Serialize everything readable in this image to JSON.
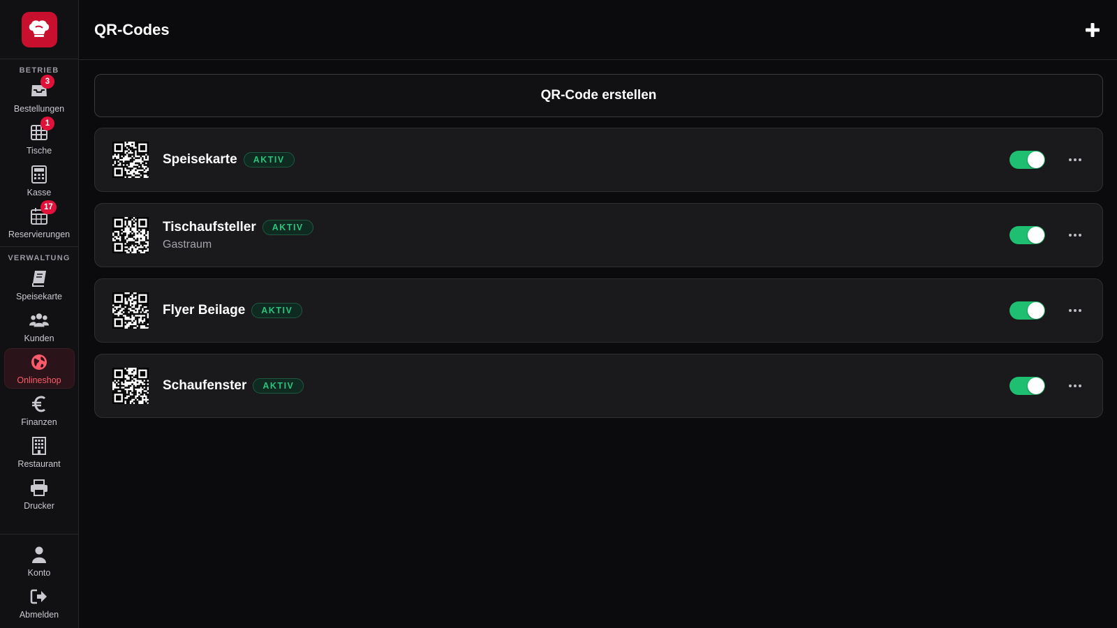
{
  "sidebar": {
    "sections": [
      {
        "label": "BETRIEB",
        "items": [
          {
            "label": "Bestellungen",
            "icon": "inbox-icon",
            "badge": "3"
          },
          {
            "label": "Tische",
            "icon": "table-grid-icon",
            "badge": "1"
          },
          {
            "label": "Kasse",
            "icon": "calculator-icon",
            "badge": ""
          },
          {
            "label": "Reservierungen",
            "icon": "calendar-icon",
            "badge": "17"
          }
        ]
      },
      {
        "label": "VERWALTUNG",
        "items": [
          {
            "label": "Speisekarte",
            "icon": "book-icon"
          },
          {
            "label": "Kunden",
            "icon": "users-icon"
          },
          {
            "label": "Onlineshop",
            "icon": "globe-icon",
            "active": true
          },
          {
            "label": "Finanzen",
            "icon": "euro-icon"
          },
          {
            "label": "Restaurant",
            "icon": "building-icon"
          },
          {
            "label": "Drucker",
            "icon": "printer-icon"
          }
        ]
      }
    ],
    "bottom": [
      {
        "label": "Konto",
        "icon": "user-icon"
      },
      {
        "label": "Abmelden",
        "icon": "logout-icon"
      }
    ]
  },
  "header": {
    "title": "QR-Codes"
  },
  "main": {
    "create_label": "QR-Code erstellen",
    "qr_codes": [
      {
        "name": "Speisekarte",
        "status": "AKTIV",
        "subtitle": "",
        "enabled": true
      },
      {
        "name": "Tischaufsteller",
        "status": "AKTIV",
        "subtitle": "Gastraum",
        "enabled": true
      },
      {
        "name": "Flyer Beilage",
        "status": "AKTIV",
        "subtitle": "",
        "enabled": true
      },
      {
        "name": "Schaufenster",
        "status": "AKTIV",
        "subtitle": "",
        "enabled": true
      }
    ]
  },
  "colors": {
    "brand": "#c8102e",
    "badge": "#e0123a",
    "active_text": "#ff5a6b",
    "status_green": "#2ec27e",
    "toggle_on": "#1fbf72"
  }
}
